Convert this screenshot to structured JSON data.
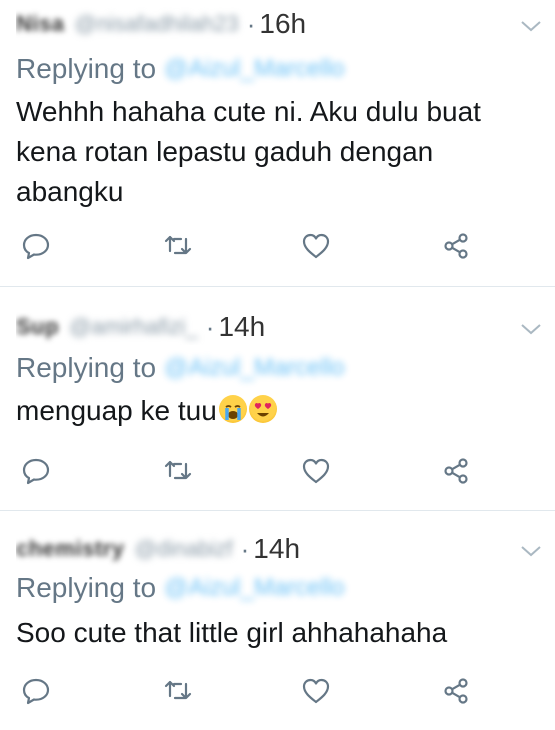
{
  "colors": {
    "separator": "#e1e8ed",
    "muted": "#657786",
    "link": "#1da1f2",
    "text": "#14171a"
  },
  "tweets": [
    {
      "display_name": "Nisa",
      "handle": "@nisafadhilah23",
      "time": "16h",
      "replying_prefix": "Replying to",
      "replying_handle": "@Aizul_Marcello",
      "text": "Wehhh hahaha cute ni. Aku dulu buat kena rotan lepastu gaduh dengan abangku",
      "emojis": []
    },
    {
      "display_name": "Sup",
      "handle": "@amirhafizi_",
      "time": "14h",
      "replying_prefix": "Replying to",
      "replying_handle": "@Aizul_Marcello",
      "text": "menguap ke tuu",
      "emojis": [
        "loudly-crying-face",
        "heart-eyes-face"
      ]
    },
    {
      "display_name": "chemistry",
      "handle": "@dinabizf",
      "time": "14h",
      "replying_prefix": "Replying to",
      "replying_handle": "@Aizul_Marcello",
      "text": "Soo cute that little girl ahhahahaha",
      "emojis": []
    }
  ],
  "actions": [
    "reply-icon",
    "retweet-icon",
    "like-icon",
    "share-icon"
  ]
}
